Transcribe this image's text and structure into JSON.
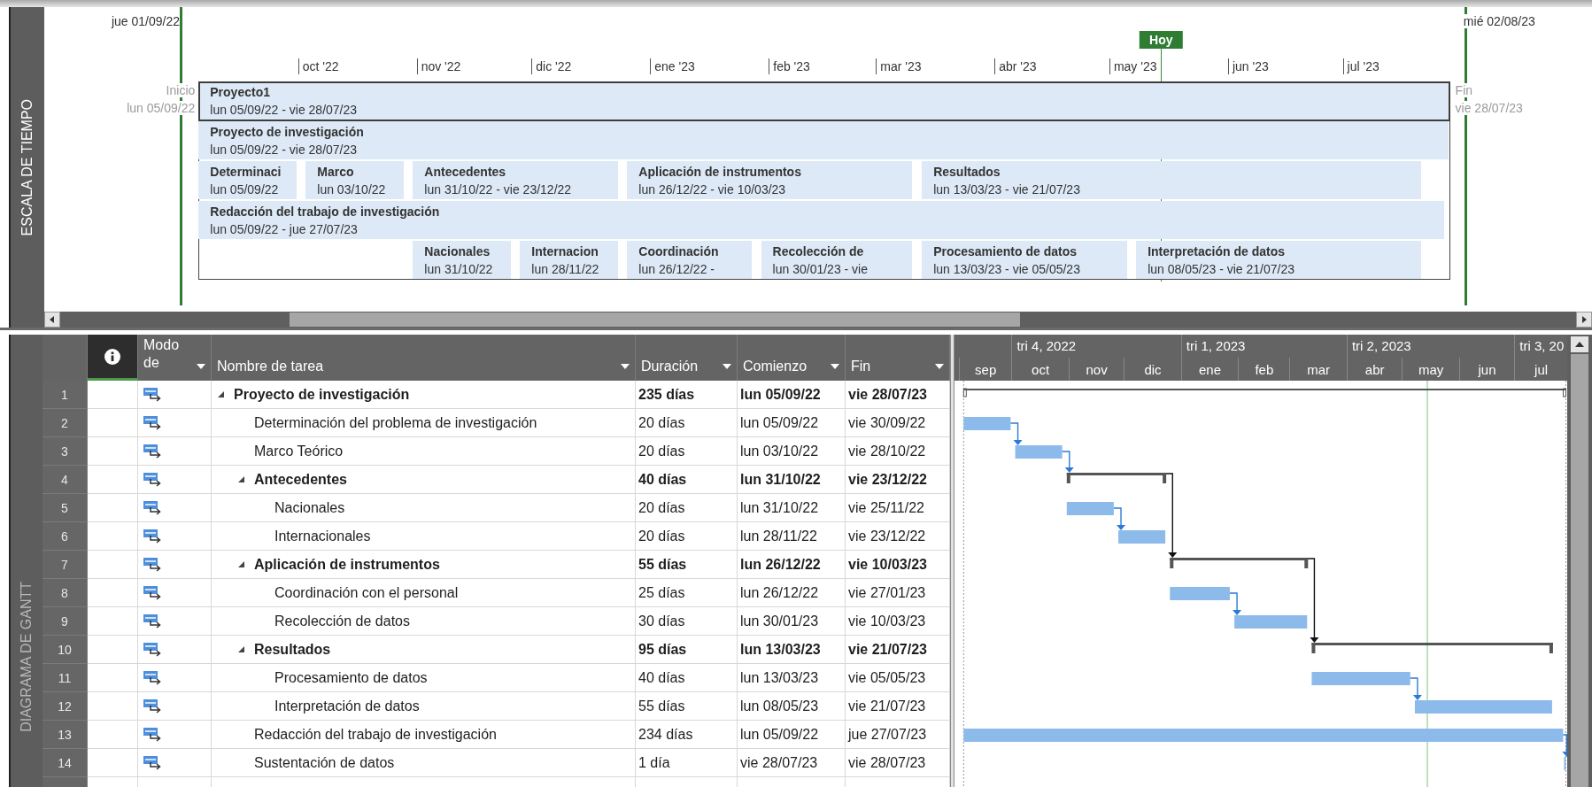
{
  "timeline": {
    "side_label": "ESCALA DE TIEMPO",
    "range_start": "jue 01/09/22",
    "range_end": "mié 02/08/23",
    "today_label": "Hoy",
    "months": [
      "oct '22",
      "nov '22",
      "dic '22",
      "ene '23",
      "feb '23",
      "mar '23",
      "abr '23",
      "may '23",
      "jun '23",
      "jul '23"
    ],
    "start_marker": {
      "label": "Inicio",
      "date": "lun 05/09/22"
    },
    "finish_marker": {
      "label": "Fin",
      "date": "vie 28/07/23"
    },
    "lanes": [
      {
        "kind": "project",
        "bars": [
          {
            "name": "Proyecto1",
            "dates": "lun 05/09/22 - vie 28/07/23"
          }
        ]
      },
      {
        "kind": "task",
        "bars": [
          {
            "name": "Proyecto de investigación",
            "dates": "lun 05/09/22 - vie 28/07/23"
          }
        ]
      },
      {
        "kind": "task",
        "bars": [
          {
            "name": "Determinaci",
            "dates": "lun 05/09/22"
          },
          {
            "name": "Marco",
            "dates": "lun 03/10/22"
          },
          {
            "name": "Antecedentes",
            "dates": "lun 31/10/22 - vie 23/12/22"
          },
          {
            "name": "Aplicación de instrumentos",
            "dates": "lun 26/12/22 - vie 10/03/23"
          },
          {
            "name": "Resultados",
            "dates": "lun 13/03/23 - vie 21/07/23"
          }
        ]
      },
      {
        "kind": "task",
        "bars": [
          {
            "name": "Redacción del trabajo de investigación",
            "dates": "lun 05/09/22 - jue 27/07/23"
          }
        ]
      },
      {
        "kind": "task",
        "bars": [
          {
            "name": "Nacionales",
            "dates": "lun 31/10/22"
          },
          {
            "name": "Internacion",
            "dates": "lun 28/11/22"
          },
          {
            "name": "Coordinación",
            "dates": "lun 26/12/22 -"
          },
          {
            "name": "Recolección de",
            "dates": "lun 30/01/23 - vie"
          },
          {
            "name": "Procesamiento de datos",
            "dates": "lun 13/03/23 - vie 05/05/23"
          },
          {
            "name": "Interpretación de datos",
            "dates": "lun 08/05/23 - vie 21/07/23"
          }
        ]
      }
    ]
  },
  "gantt": {
    "side_label": "DIAGRAMA DE GANTT",
    "columns": [
      {
        "kind": "info"
      },
      {
        "kind": "text",
        "label": "Modo de"
      },
      {
        "kind": "text",
        "label": "Nombre de tarea"
      },
      {
        "kind": "text",
        "label": "Duración"
      },
      {
        "kind": "text",
        "label": "Comienzo"
      },
      {
        "kind": "text",
        "label": "Fin"
      }
    ],
    "timescale": {
      "quarters": [
        "tri 4, 2022",
        "tri 1, 2023",
        "tri 2, 2023",
        "tri 3, 20"
      ],
      "months": [
        "sep",
        "oct",
        "nov",
        "dic",
        "ene",
        "feb",
        "mar",
        "abr",
        "may",
        "jun",
        "jul"
      ]
    },
    "tasks": [
      {
        "id": "1",
        "name": "Proyecto de investigación",
        "duration": "235 días",
        "start": "lun 05/09/22",
        "finish": "vie 28/07/23",
        "expanded": true,
        "children": [
          {
            "id": "2",
            "name": "Determinación del problema de investigación",
            "duration": "20 días",
            "start": "lun 05/09/22",
            "finish": "vie 30/09/22"
          },
          {
            "id": "3",
            "name": "Marco Teórico",
            "duration": "20 días",
            "start": "lun 03/10/22",
            "finish": "vie 28/10/22"
          },
          {
            "id": "4",
            "name": "Antecedentes",
            "duration": "40 días",
            "start": "lun 31/10/22",
            "finish": "vie 23/12/22",
            "expanded": true,
            "children": [
              {
                "id": "5",
                "name": "Nacionales",
                "duration": "20 días",
                "start": "lun 31/10/22",
                "finish": "vie 25/11/22"
              },
              {
                "id": "6",
                "name": "Internacionales",
                "duration": "20 días",
                "start": "lun 28/11/22",
                "finish": "vie 23/12/22"
              }
            ]
          },
          {
            "id": "7",
            "name": "Aplicación de instrumentos",
            "duration": "55 días",
            "start": "lun 26/12/22",
            "finish": "vie 10/03/23",
            "expanded": true,
            "children": [
              {
                "id": "8",
                "name": "Coordinación con el personal",
                "duration": "25 días",
                "start": "lun 26/12/22",
                "finish": "vie 27/01/23"
              },
              {
                "id": "9",
                "name": "Recolección de datos",
                "duration": "30 días",
                "start": "lun 30/01/23",
                "finish": "vie 10/03/23"
              }
            ]
          },
          {
            "id": "10",
            "name": "Resultados",
            "duration": "95 días",
            "start": "lun 13/03/23",
            "finish": "vie 21/07/23",
            "expanded": true,
            "children": [
              {
                "id": "11",
                "name": "Procesamiento de datos",
                "duration": "40 días",
                "start": "lun 13/03/23",
                "finish": "vie 05/05/23"
              },
              {
                "id": "12",
                "name": "Interpretación de datos",
                "duration": "55 días",
                "start": "lun 08/05/23",
                "finish": "vie 21/07/23"
              }
            ]
          },
          {
            "id": "13",
            "name": "Redacción del trabajo de investigación",
            "duration": "234 días",
            "start": "lun 05/09/22",
            "finish": "jue 27/07/23"
          },
          {
            "id": "14",
            "name": "Sustentación de datos",
            "duration": "1 día",
            "start": "vie 28/07/23",
            "finish": "vie 28/07/23"
          }
        ]
      }
    ]
  }
}
